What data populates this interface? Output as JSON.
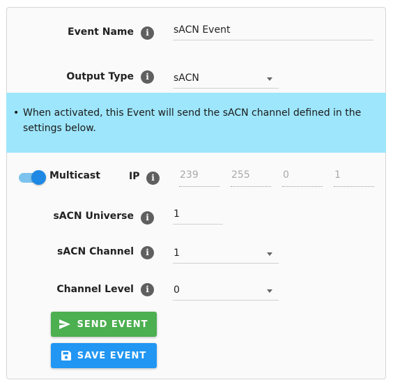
{
  "form": {
    "event_name": {
      "label": "Event Name",
      "value": "sACN Event"
    },
    "output_type": {
      "label": "Output Type",
      "value": "sACN"
    },
    "info_text": "When activated, this Event will send the sACN channel defined in the settings below.",
    "multicast": {
      "label": "Multicast",
      "enabled": true
    },
    "ip": {
      "label": "IP",
      "octets": [
        "239",
        "255",
        "0",
        "1"
      ]
    },
    "universe": {
      "label": "sACN Universe",
      "value": "1"
    },
    "channel": {
      "label": "sACN Channel",
      "value": "1"
    },
    "level": {
      "label": "Channel Level",
      "value": "0"
    }
  },
  "buttons": {
    "send": {
      "label": "SEND EVENT",
      "color": "#4caf50",
      "icon": "send-icon"
    },
    "save": {
      "label": "SAVE EVENT",
      "color": "#2196f3",
      "icon": "save-icon"
    }
  },
  "colors": {
    "banner": "#9ee6fb",
    "toggle_on": "#1e88e5"
  }
}
